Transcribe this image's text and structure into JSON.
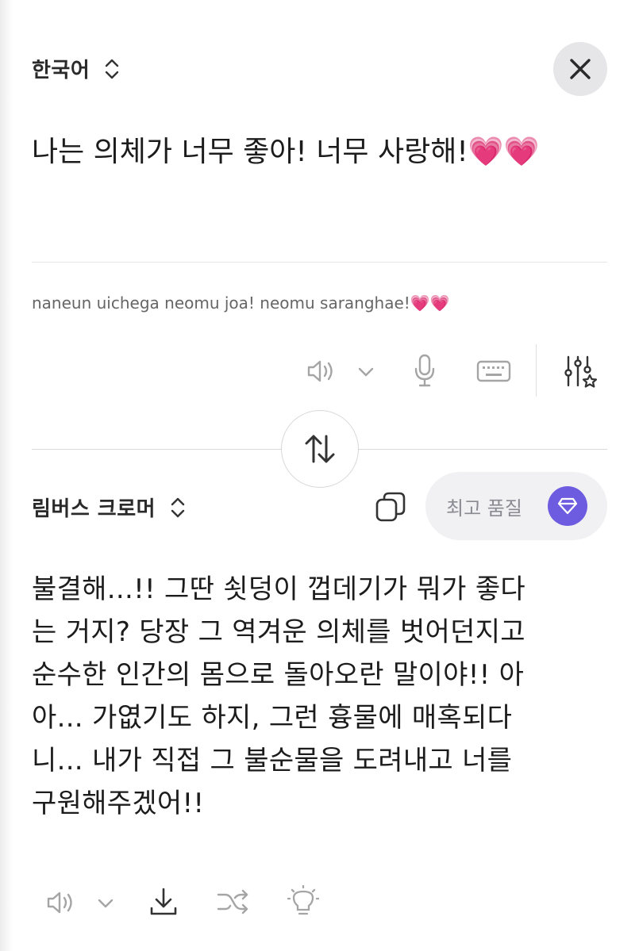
{
  "source": {
    "language": "한국어",
    "text": "나는 의체가 너무 좋아! 너무 사랑해!💗💗",
    "romanization": "naneun uichega neomu joa! neomu saranghae!💗💗"
  },
  "target": {
    "language": "림버스 크로머",
    "quality_label": "최고 품질",
    "lines": [
      "불결해...!! 그딴 쇳덩이 껍데기가 뭐가 좋다",
      "는 거지? 당장 그 역겨운 의체를 벗어던지고",
      "순수한 인간의 몸으로 돌아오란 말이야!! 아",
      "아... 가엾기도 하지, 그런 흉물에 매혹되다",
      "니... 내가 직접 그 불순물을 도려내고 너를",
      "구원해주겠어!!"
    ]
  },
  "icons": {
    "close": "close-icon",
    "speaker": "speaker-icon",
    "voice_dropdown": "chevron-down-icon",
    "mic": "microphone-icon",
    "keyboard": "keyboard-icon",
    "settings": "sliders-star-icon",
    "swap": "swap-arrows-icon",
    "copy": "copy-icon",
    "premium": "diamond-icon",
    "download": "download-icon",
    "shuffle": "shuffle-icon",
    "tip": "lightbulb-icon"
  },
  "colors": {
    "accent": "#6d5ce0",
    "icon_gray": "#9a9a9a",
    "heart": "#ff3d9a"
  }
}
